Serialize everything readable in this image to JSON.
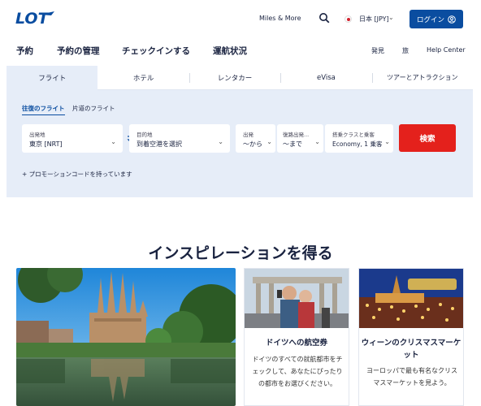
{
  "header": {
    "logo_text": "LOT",
    "miles_link": "Miles & More",
    "language": "日本 [JPY]",
    "login_label": "ログイン"
  },
  "nav": {
    "items": [
      "予約",
      "予約の管理",
      "チェックインする",
      "運航状況"
    ],
    "right_items": [
      "発見",
      "旅",
      "Help Center"
    ]
  },
  "booking": {
    "tabs": [
      "フライト",
      "ホテル",
      "レンタカー",
      "eVisa",
      "ツアーとアトラクション"
    ],
    "active_tab": "フライト",
    "trip_types": [
      "往復のフライト",
      "片道のフライト"
    ],
    "from": {
      "label": "出発地",
      "value": "東京 [NRT]"
    },
    "to": {
      "label": "目的地",
      "value": "到着空港を選択"
    },
    "depart": {
      "label": "出発",
      "value": "〜から"
    },
    "return": {
      "label": "復路出発...",
      "value": "〜まで"
    },
    "cabin": {
      "label": "搭乗クラスと乗客",
      "value": "Economy, 1 乗客"
    },
    "search_label": "検索",
    "promo_label": "+ プロモーションコードを持っています"
  },
  "inspiration": {
    "title": "インスピレーションを得る",
    "cards": [
      {
        "title": "ドイツへの航空券",
        "text": "ドイツのすべての就航都市をチェックして、あなたにぴったりの都市をお選びください。"
      },
      {
        "title": "ウィーンのクリスマスマーケット",
        "text": "ヨーロッパで最も有名なクリスマスマーケットを見よう。"
      }
    ]
  },
  "colors": {
    "brand_blue": "#0a4da0",
    "search_red": "#e4211c",
    "panel_bg": "#e6edf8"
  }
}
